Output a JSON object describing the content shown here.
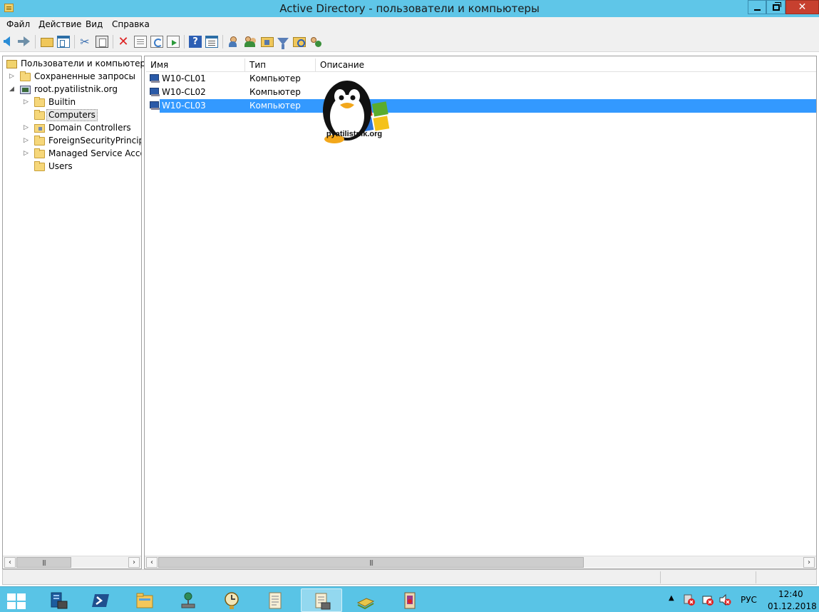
{
  "window": {
    "title": "Active Directory - пользователи и компьютеры"
  },
  "menu": [
    "Файл",
    "Действие",
    "Вид",
    "Справка"
  ],
  "tree": {
    "root": "Пользователи и компьютеры Active Directory",
    "root_visible": "Пользователи и компьютеры",
    "saved_queries": "Сохраненные запросы",
    "domain": "root.pyatilistnik.org",
    "children": [
      {
        "label": "Builtin",
        "type": "folder",
        "expandable": true
      },
      {
        "label": "Computers",
        "type": "folder",
        "expandable": false,
        "selected": true
      },
      {
        "label": "Domain Controllers",
        "type": "ou",
        "expandable": true
      },
      {
        "label": "ForeignSecurityPrincipals",
        "type": "folder",
        "expandable": true
      },
      {
        "label": "Managed Service Accounts",
        "type": "folder",
        "expandable": true
      },
      {
        "label": "Users",
        "type": "folder",
        "expandable": false
      }
    ]
  },
  "list": {
    "columns": [
      "Имя",
      "Тип",
      "Описание"
    ],
    "rows": [
      {
        "name": "W10-CL01",
        "type": "Компьютер",
        "description": "",
        "selected": false
      },
      {
        "name": "W10-CL02",
        "type": "Компьютер",
        "description": "",
        "selected": false
      },
      {
        "name": "W10-CL03",
        "type": "Компьютер",
        "description": "",
        "selected": true
      }
    ]
  },
  "watermark": {
    "text": "pyatilistnik.org"
  },
  "tray": {
    "language": "РУС",
    "time": "12:40",
    "date": "01.12.2018"
  },
  "colors": {
    "titlebar": "#5fc6e8",
    "taskbar": "#59c4e6",
    "selection": "#3399ff",
    "close": "#c7402f"
  }
}
